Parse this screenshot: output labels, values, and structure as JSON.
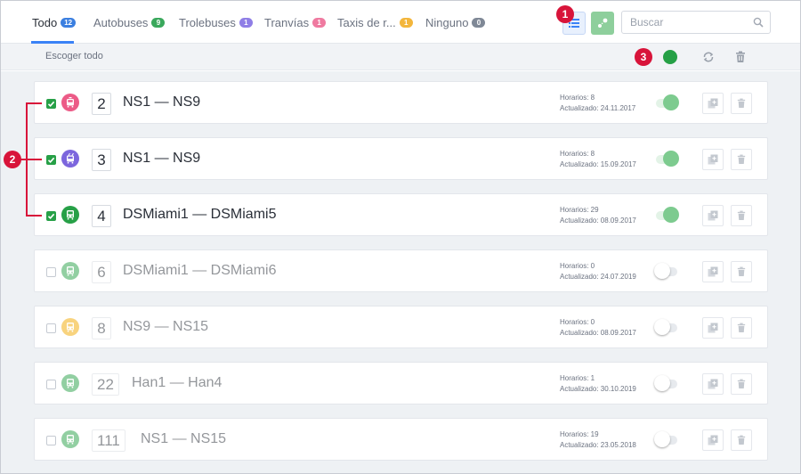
{
  "tabs": [
    {
      "label": "Todo",
      "count": "12",
      "color": "#3b7fe0"
    },
    {
      "label": "Autobuses",
      "count": "9",
      "color": "#3aa85c"
    },
    {
      "label": "Trolebuses",
      "count": "1",
      "color": "#8f7ee6"
    },
    {
      "label": "Tranvías",
      "count": "1",
      "color": "#ef7aa0"
    },
    {
      "label": "Taxis de r...",
      "count": "1",
      "color": "#f3b63c"
    },
    {
      "label": "Ninguno",
      "count": "0",
      "color": "#7f8896"
    }
  ],
  "toolbar": {
    "search_placeholder": "Buscar",
    "select_all_label": "Escoger todo"
  },
  "callouts": [
    "1",
    "2",
    "3"
  ],
  "colors": {
    "accent": "#3b82f6",
    "active_green": "#27a047",
    "callout_red": "#d8143a"
  },
  "routes": [
    {
      "number": "2",
      "name": "NS1 — NS9",
      "type": "tram-icon",
      "type_color": "#ec5b87",
      "checked": true,
      "active": true,
      "schedules": "Horarios: 8",
      "updated": "Actualizado: 24.11.2017"
    },
    {
      "number": "3",
      "name": "NS1 — NS9",
      "type": "trolleybus-icon",
      "type_color": "#7c66dd",
      "checked": true,
      "active": true,
      "schedules": "Horarios: 8",
      "updated": "Actualizado: 15.09.2017"
    },
    {
      "number": "4",
      "name": "DSMiami1 — DSMiami5",
      "type": "bus-icon",
      "type_color": "#27a047",
      "checked": true,
      "active": true,
      "schedules": "Horarios: 29",
      "updated": "Actualizado: 08.09.2017"
    },
    {
      "number": "6",
      "name": "DSMiami1 — DSMiami6",
      "type": "bus-icon",
      "type_color": "#27a047",
      "checked": false,
      "active": false,
      "schedules": "Horarios: 0",
      "updated": "Actualizado: 24.07.2019"
    },
    {
      "number": "8",
      "name": "NS9 — NS15",
      "type": "taxi-icon",
      "type_color": "#f2a900",
      "checked": false,
      "active": false,
      "schedules": "Horarios: 0",
      "updated": "Actualizado: 08.09.2017"
    },
    {
      "number": "22",
      "name": "Han1 — Han4",
      "type": "bus-icon",
      "type_color": "#27a047",
      "checked": false,
      "active": false,
      "schedules": "Horarios: 1",
      "updated": "Actualizado: 30.10.2019"
    },
    {
      "number": "111",
      "name": "NS1 — NS15",
      "type": "bus-icon",
      "type_color": "#27a047",
      "checked": false,
      "active": false,
      "schedules": "Horarios: 19",
      "updated": "Actualizado: 23.05.2018"
    }
  ]
}
